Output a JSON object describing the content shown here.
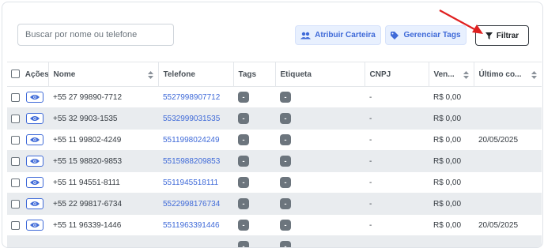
{
  "toolbar": {
    "search_placeholder": "Buscar por nome ou telefone",
    "assign_label": "Atribuir Carteira",
    "manage_tags_label": "Gerenciar Tags",
    "filter_label": "Filtrar"
  },
  "table": {
    "headers": {
      "actions": "Ações",
      "name": "Nome",
      "phone": "Telefone",
      "tags": "Tags",
      "label": "Etiqueta",
      "cnpj": "CNPJ",
      "sales": "Ven...",
      "last": "Último co..."
    },
    "rows": [
      {
        "name": "+55 27 99890-7712",
        "phone": "5527998907712",
        "tag": "-",
        "label": "-",
        "cnpj": "-",
        "sales": "R$ 0,00",
        "last": ""
      },
      {
        "name": "+55 32 9903-1535",
        "phone": "5532999031535",
        "tag": "-",
        "label": "-",
        "cnpj": "-",
        "sales": "R$ 0,00",
        "last": ""
      },
      {
        "name": "+55 11 99802-4249",
        "phone": "5511998024249",
        "tag": "-",
        "label": "-",
        "cnpj": "-",
        "sales": "R$ 0,00",
        "last": "20/05/2025"
      },
      {
        "name": "+55 15 98820-9853",
        "phone": "5515988209853",
        "tag": "-",
        "label": "-",
        "cnpj": "-",
        "sales": "R$ 0,00",
        "last": ""
      },
      {
        "name": "+55 11 94551-8111",
        "phone": "5511945518111",
        "tag": "-",
        "label": "-",
        "cnpj": "-",
        "sales": "R$ 0,00",
        "last": ""
      },
      {
        "name": "+55 22 99817-6734",
        "phone": "5522998176734",
        "tag": "-",
        "label": "-",
        "cnpj": "-",
        "sales": "R$ 0,00",
        "last": ""
      },
      {
        "name": "+55 11 96339-1446",
        "phone": "5511963391446",
        "tag": "-",
        "label": "-",
        "cnpj": "-",
        "sales": "R$ 0,00",
        "last": "20/05/2025"
      },
      {
        "name": "",
        "phone": "",
        "tag": "-",
        "label": "-",
        "cnpj": "",
        "sales": "",
        "last": ""
      }
    ]
  },
  "colors": {
    "accent": "#3f6ad8",
    "badge": "#6c757d",
    "alt_row": "#e9ecef",
    "annotation_arrow": "#e02020"
  },
  "icons": {
    "assign": "users-icon",
    "tags": "tags-icon",
    "filter": "filter-funnel-icon",
    "row_action": "eye-icon",
    "sort": "sort-icon"
  }
}
